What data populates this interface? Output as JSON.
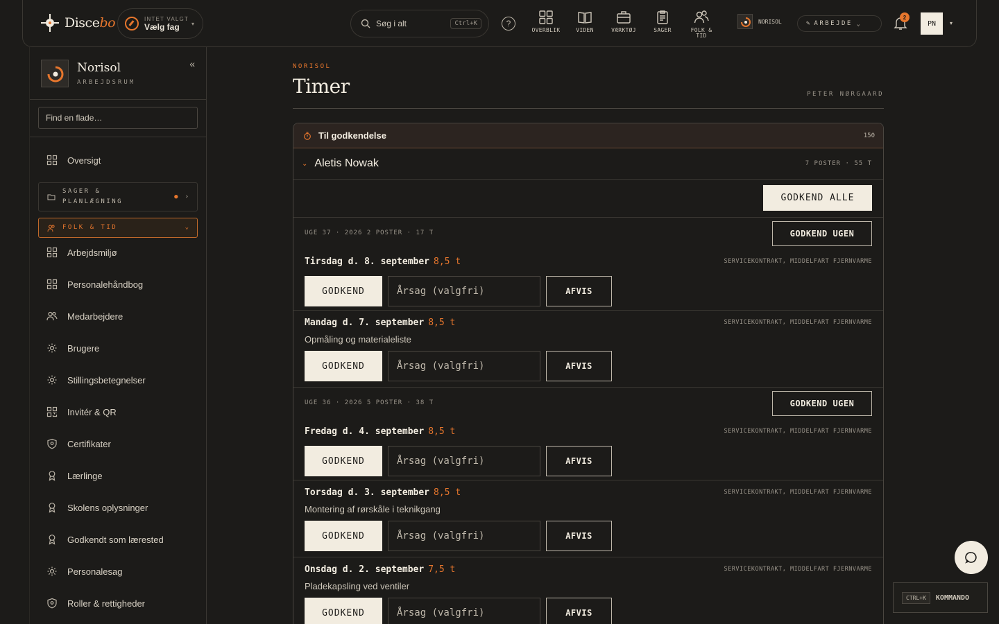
{
  "header": {
    "logo_main": "Disce",
    "logo_accent": "bo",
    "trade_small": "INTET VALGT",
    "trade_value": "Vælg fag",
    "search_label": "Søg i alt",
    "search_kbd": "Ctrl+K",
    "help": "?",
    "nav": [
      {
        "label": "OVERBLIK",
        "icon": "grid-icon"
      },
      {
        "label": "VIDEN",
        "icon": "book-icon"
      },
      {
        "label": "VÆRKTØJ",
        "icon": "briefcase-icon"
      },
      {
        "label": "SAGER",
        "icon": "clipboard-icon"
      },
      {
        "label_line1": "FOLK &",
        "label_line2": "TID",
        "icon": "people-icon"
      }
    ],
    "org": "NORISOL",
    "mode": "ARBEJDE",
    "notifications": "2",
    "avatar": "PN"
  },
  "sidebar": {
    "workspace_name": "Norisol",
    "workspace_sub": "ARBEJDSRUM",
    "find_placeholder": "Find en flade…",
    "overview": "Oversigt",
    "group_cases_line1": "SAGER &",
    "group_cases_line2": "PLANLÆGNING",
    "group_people": "FOLK & TID",
    "items": [
      {
        "label": "Arbejdsmiljø",
        "icon": "grid-icon"
      },
      {
        "label": "Personalehåndbog",
        "icon": "grid-icon"
      },
      {
        "label": "Medarbejdere",
        "icon": "people-icon"
      },
      {
        "label": "Brugere",
        "icon": "sun-icon"
      },
      {
        "label": "Stillingsbetegnelser",
        "icon": "sun-icon"
      },
      {
        "label": "Invitér & QR",
        "icon": "qr-icon"
      },
      {
        "label": "Certifikater",
        "icon": "shield-icon"
      },
      {
        "label": "Lærlinge",
        "icon": "ribbon-icon"
      },
      {
        "label": "Skolens oplysninger",
        "icon": "ribbon-icon"
      },
      {
        "label": "Godkendt som lærested",
        "icon": "ribbon-icon"
      },
      {
        "label": "Personalesag",
        "icon": "sun-icon"
      },
      {
        "label": "Roller & rettigheder",
        "icon": "shield-icon"
      }
    ]
  },
  "main": {
    "eyebrow": "NORISOL",
    "title": "Timer",
    "user": "PETER NØRGAARD",
    "panel_title": "Til godkendelse",
    "panel_count": "150",
    "person_name": "Aletis Nowak",
    "person_meta": "7 POSTER · 55 T",
    "approve_all": "GODKEND ALLE",
    "approve_week": "GODKEND UGEN",
    "approve": "GODKEND",
    "reject": "AFVIS",
    "reason_placeholder": "Årsag (valgfri)",
    "weeks": [
      {
        "label": "UGE 37 · 2026  2 POSTER · 17 T",
        "days": [
          {
            "title": "Tirsdag d. 8. september",
            "hours": "8,5 t",
            "note": "",
            "tag": "SERVICEKONTRAKT, MIDDELFART FJERNVARME"
          },
          {
            "title": "Mandag d. 7. september",
            "hours": "8,5 t",
            "note": "Opmåling og materialeliste",
            "tag": "SERVICEKONTRAKT, MIDDELFART FJERNVARME"
          }
        ]
      },
      {
        "label": "UGE 36 · 2026  5 POSTER · 38 T",
        "days": [
          {
            "title": "Fredag d. 4. september",
            "hours": "8,5 t",
            "note": "",
            "tag": "SERVICEKONTRAKT, MIDDELFART FJERNVARME"
          },
          {
            "title": "Torsdag d. 3. september",
            "hours": "8,5 t",
            "note": "Montering af rørskåle i teknikgang",
            "tag": "SERVICEKONTRAKT, MIDDELFART FJERNVARME"
          },
          {
            "title": "Onsdag d. 2. september",
            "hours": "7,5 t",
            "note": "Pladekapsling ved ventiler",
            "tag": "SERVICEKONTRAKT, MIDDELFART FJERNVARME"
          }
        ]
      }
    ]
  },
  "floating": {
    "cmd_kbd": "CTRL+K",
    "cmd_label": "KOMMANDO"
  },
  "colors": {
    "accent": "#e6762d",
    "background": "#1c1b19",
    "button_light": "#f2ece0"
  }
}
